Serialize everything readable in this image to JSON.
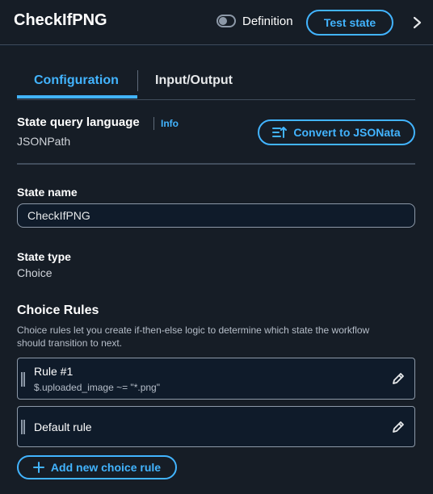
{
  "header": {
    "title": "CheckIfPNG",
    "toggle_label": "Definition",
    "test_state_label": "Test state"
  },
  "tabs": [
    {
      "label": "Configuration",
      "active": true
    },
    {
      "label": "Input/Output",
      "active": false
    }
  ],
  "query_language": {
    "label": "State query language",
    "info": "Info",
    "value": "JSONPath",
    "convert_label": "Convert to JSONata"
  },
  "state_name": {
    "label": "State name",
    "value": "CheckIfPNG"
  },
  "state_type": {
    "label": "State type",
    "value": "Choice"
  },
  "choice_rules": {
    "heading": "Choice Rules",
    "description": "Choice rules let you create if-then-else logic to determine which state the workflow should transition to next.",
    "rules": [
      {
        "title": "Rule #1",
        "expression": "$.uploaded_image ~= \"*.png\""
      },
      {
        "title": "Default rule"
      }
    ],
    "add_label": "Add new choice rule"
  },
  "colors": {
    "accent": "#42b4ff",
    "background": "#0f1b2a",
    "panel": "#161d26"
  }
}
